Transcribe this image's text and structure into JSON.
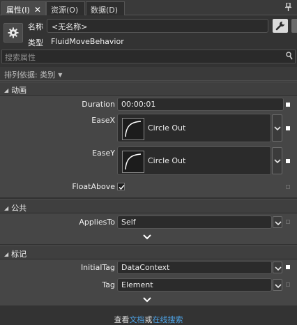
{
  "tabs": [
    {
      "label": "属性(I)",
      "close": "✕"
    },
    {
      "label": "资源(O)"
    },
    {
      "label": "数据(D)"
    }
  ],
  "header": {
    "name_label": "名称",
    "name_value": "<无名称>",
    "type_label": "类型",
    "type_value": "FluidMoveBehavior"
  },
  "search": {
    "placeholder": "搜索属性"
  },
  "sort": {
    "label": "排列依据: 类别",
    "caret": "▼"
  },
  "sections": {
    "animation": {
      "title": "动画",
      "duration_label": "Duration",
      "duration_value": "00:00:01",
      "easex_label": "EaseX",
      "easex_value": "Circle Out",
      "easey_label": "EaseY",
      "easey_value": "Circle Out",
      "floatabove_label": "FloatAbove",
      "floatabove_checked": true
    },
    "common": {
      "title": "公共",
      "appliesto_label": "AppliesTo",
      "appliesto_value": "Self"
    },
    "tags": {
      "title": "标记",
      "initialtag_label": "InitialTag",
      "initialtag_value": "DataContext",
      "tag_label": "Tag",
      "tag_value": "Element"
    }
  },
  "footer": {
    "prefix": "查看",
    "link1": "文档",
    "mid": "或",
    "link2": "在线搜索"
  },
  "colors": {
    "background": "#333333",
    "panel": "#464646",
    "link": "#4ea3e6"
  }
}
